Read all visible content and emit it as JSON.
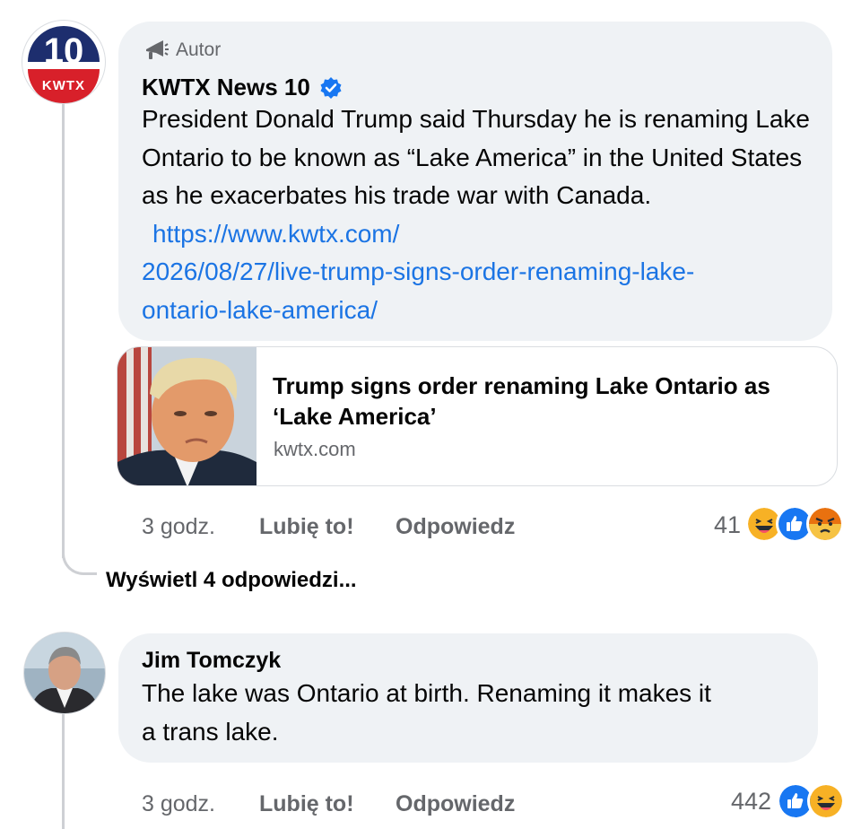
{
  "comment1": {
    "author_badge": "Autor",
    "name": "KWTX News 10",
    "avatar_logo_text": "10",
    "avatar_logo_sub": "KWTX",
    "text": "President Donald Trump said Thursday he is renaming Lake Ontario to be known as “Lake America” in the United States as he exacerbates his trade war with Canada.",
    "link_line1": "https://www.kwtx.com/",
    "link_line2": "2026/08/27/live-trump-signs-order-renaming-lake-",
    "link_line3": "ontario-lake-america/",
    "preview": {
      "title": "Trump signs order renaming Lake Ontario as ‘Lake America’",
      "domain": "kwtx.com",
      "thumbnail_icon": "person-photo"
    },
    "time": "3 godz.",
    "like_label": "Lubię to!",
    "reply_label": "Odpowiedz",
    "reaction_count": "41",
    "reactions": [
      "haha",
      "like",
      "angry"
    ]
  },
  "view_replies_label": "Wyświetl 4 odpowiedzi...",
  "comment2": {
    "name": "Jim Tomczyk",
    "text_line1": "The lake was Ontario at birth. Renaming it makes it",
    "text_line2": "a trans lake.",
    "time": "3 godz.",
    "like_label": "Lubię to!",
    "reply_label": "Odpowiedz",
    "reaction_count": "442",
    "reactions": [
      "like",
      "haha"
    ]
  },
  "colors": {
    "bubble": "#eff2f5",
    "link": "#1b74e4",
    "secondary_text": "#65676b",
    "like_blue": "#1877f2",
    "haha_yellow": "#f7b125",
    "angry_red": "#e9710f",
    "kwtx_blue": "#1d2e6e",
    "kwtx_red": "#d8202a"
  }
}
